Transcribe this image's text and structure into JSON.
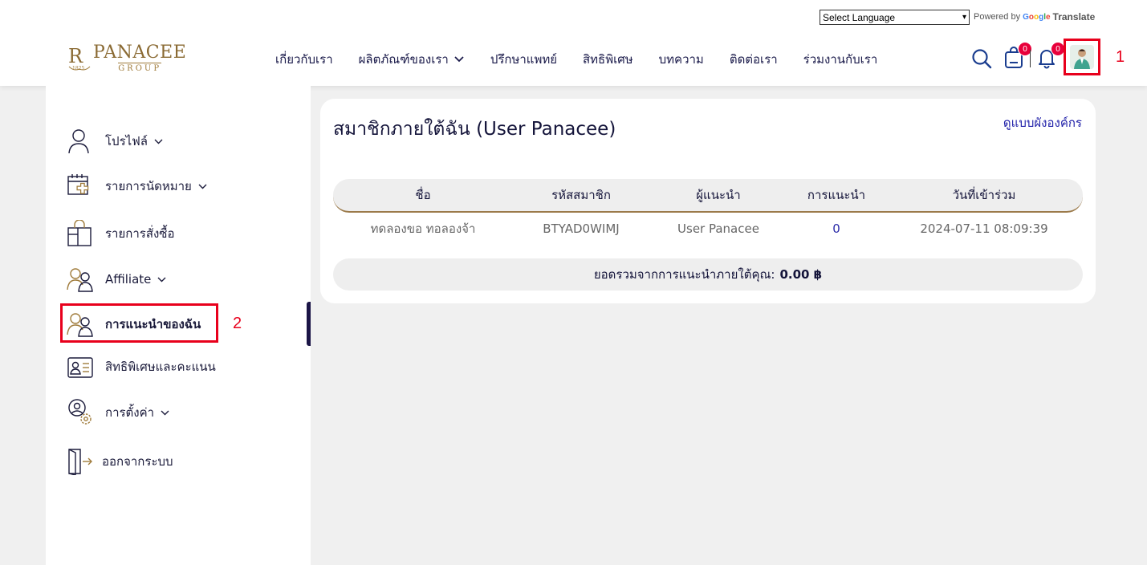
{
  "header": {
    "language_select": "Select Language",
    "powered_by": "Powered by",
    "google": "Google",
    "translate": "Translate",
    "logo": {
      "brand": "PANACEE",
      "group": "GROUP"
    },
    "nav": [
      {
        "label": "เกี่ยวกับเรา",
        "has_dropdown": false
      },
      {
        "label": "ผลิตภัณฑ์ของเรา",
        "has_dropdown": true
      },
      {
        "label": "ปรึกษาแพทย์",
        "has_dropdown": false
      },
      {
        "label": "สิทธิพิเศษ",
        "has_dropdown": false
      },
      {
        "label": "บทความ",
        "has_dropdown": false
      },
      {
        "label": "ติดต่อเรา",
        "has_dropdown": false
      },
      {
        "label": "ร่วมงานกับเรา",
        "has_dropdown": false
      }
    ],
    "cart_count": "0",
    "notification_count": "0",
    "annotation_1": "1"
  },
  "sidebar": {
    "items": [
      {
        "label": "โปรไฟล์",
        "icon": "user-icon",
        "has_dropdown": true
      },
      {
        "label": "รายการนัดหมาย",
        "icon": "calendar-plus-icon",
        "has_dropdown": true
      },
      {
        "label": "รายการสั่งซื้อ",
        "icon": "shopping-bag-icon",
        "has_dropdown": false
      },
      {
        "label": "Affiliate",
        "icon": "users-icon",
        "has_dropdown": true
      },
      {
        "label": "การแนะนำของฉัน",
        "icon": "users-icon",
        "has_dropdown": false,
        "active": true
      },
      {
        "label": "สิทธิพิเศษและคะแนน",
        "icon": "id-card-icon",
        "has_dropdown": false
      },
      {
        "label": "การตั้งค่า",
        "icon": "user-settings-icon",
        "has_dropdown": true
      },
      {
        "label": "ออกจากระบบ",
        "icon": "logout-icon",
        "has_dropdown": false
      }
    ],
    "annotation_2": "2"
  },
  "main": {
    "title": "สมาชิกภายใต้ฉัน (User Panacee)",
    "org_chart_link": "ดูแบบผังองค์กร",
    "table": {
      "headers": [
        "ชื่อ",
        "รหัสสมาชิก",
        "ผู้แนะนำ",
        "การแนะนำ",
        "วันที่เข้าร่วม"
      ],
      "rows": [
        [
          "ทดลองขอ ทอลองจ้า",
          "BTYAD0WIMJ",
          "User Panacee",
          "0",
          "2024-07-11 08:09:39"
        ]
      ]
    },
    "total_label": "ยอดรวมจากการแนะนำภายใต้คุณ:",
    "total_value": "0.00 ฿"
  },
  "colors": {
    "accent_navy": "#1b1546",
    "gold": "#9b7a4a",
    "badge_red": "#e8003b",
    "annotation_red": "#e8001c",
    "link_blue": "#1e1ea8"
  }
}
